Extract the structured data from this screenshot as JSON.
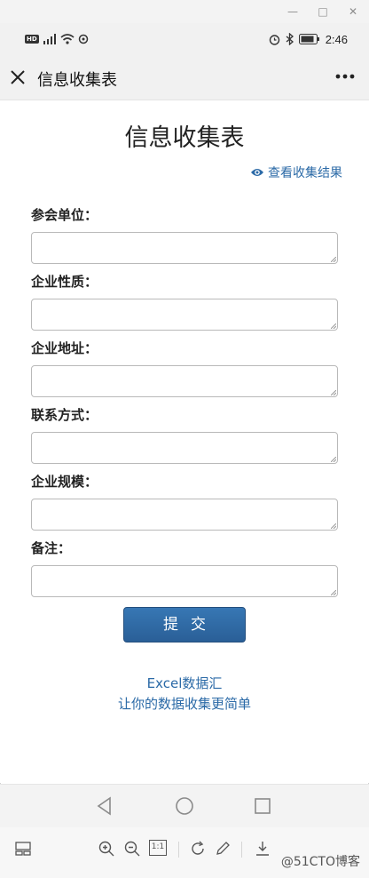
{
  "status_bar": {
    "time": "2:46",
    "hd_badge": "HD"
  },
  "app_bar": {
    "title": "信息收集表"
  },
  "form": {
    "title": "信息收集表",
    "view_results_label": "查看收集结果",
    "fields": [
      {
        "label": "参会单位：",
        "value": "",
        "placeholder": ""
      },
      {
        "label": "企业性质：",
        "value": "",
        "placeholder": ""
      },
      {
        "label": "企业地址：",
        "value": "",
        "placeholder": ""
      },
      {
        "label": "联系方式：",
        "value": "",
        "placeholder": ""
      },
      {
        "label": "企业规模：",
        "value": "",
        "placeholder": ""
      },
      {
        "label": "备注：",
        "value": "",
        "placeholder": ""
      }
    ],
    "submit_label": "提交"
  },
  "footer": {
    "line1": "Excel数据汇",
    "line2": "让你的数据收集更简单"
  },
  "toolbar": {
    "zoom_ratio_label": "1:1"
  },
  "watermark": "@51CTO博客",
  "colors": {
    "accent": "#2b6aa7",
    "button": "#2f6aa6"
  }
}
